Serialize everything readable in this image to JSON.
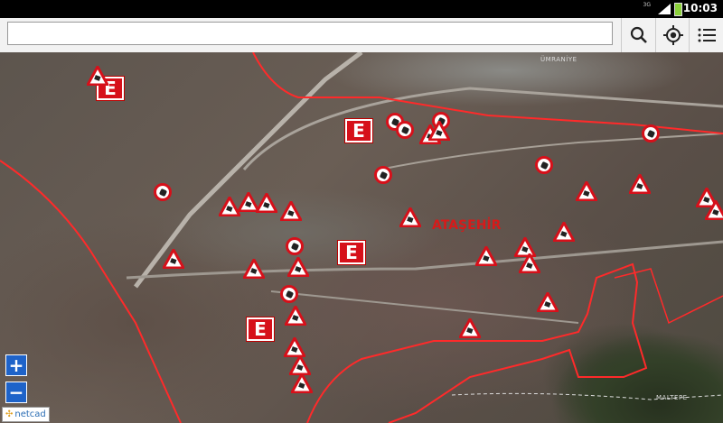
{
  "status": {
    "time": "10:03",
    "network": "3G"
  },
  "search": {
    "value": "",
    "placeholder": ""
  },
  "toolbar": {
    "search_icon": "search-icon",
    "locate_icon": "gps-locate-icon",
    "menu_icon": "list-menu-icon"
  },
  "map": {
    "labels": {
      "district": "ATAŞEHİR",
      "north": "ÜMRANİYE",
      "south": "MALTEPE"
    },
    "emergency_marker_text": "E",
    "colors": {
      "boundary": "#ff2a2a",
      "marker_red": "#d6101a",
      "zoom_blue": "#1e63c9"
    }
  },
  "zoom": {
    "in": "+",
    "out": "−"
  },
  "attribution": "netcad"
}
